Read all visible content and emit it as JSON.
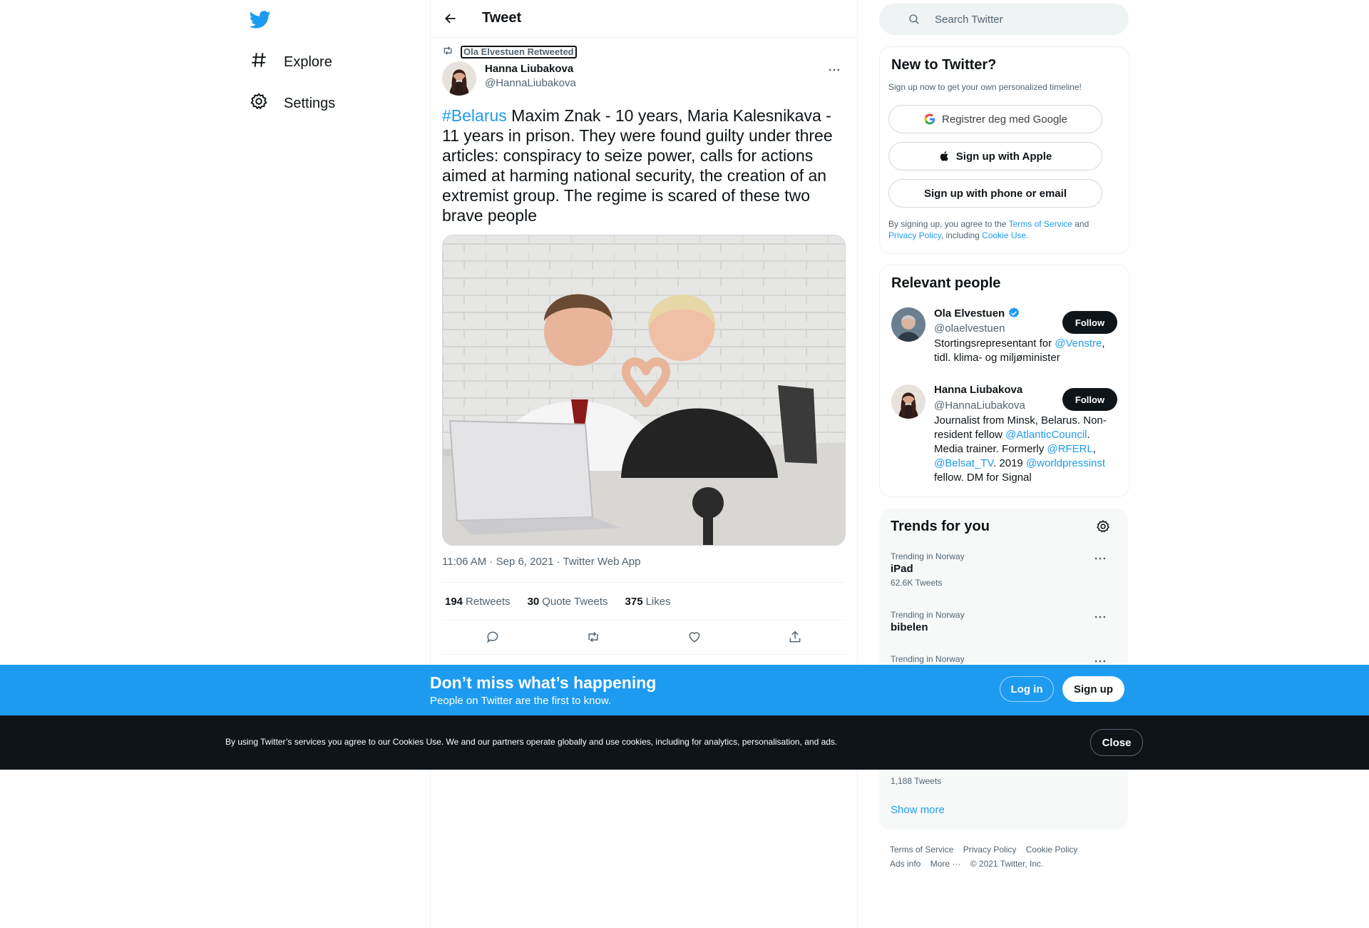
{
  "nav": {
    "items": [
      {
        "label": "Explore",
        "icon": "hashtag-icon"
      },
      {
        "label": "Settings",
        "icon": "gear-icon"
      }
    ]
  },
  "header": {
    "title": "Tweet"
  },
  "tweet": {
    "retweeted_by": "Ola Elvestuen Retweeted",
    "author_name": "Hanna Liubakova",
    "author_handle": "@HannaLiubakova",
    "hashtag": "#Belarus",
    "text": " Maxim Znak - 10 years, Maria Kalesnikava - 11 years in prison. They were found guilty under three articles: conspiracy to seize power, calls for actions aimed at harming national security, the creation of an extremist group. The regime is scared of these two brave people",
    "meta": "11:06 AM · Sep 6, 2021 · Twitter Web App",
    "retweets_count": "194",
    "retweets_label": "Retweets",
    "quotes_count": "30",
    "quotes_label": "Quote Tweets",
    "likes_count": "375",
    "likes_label": "Likes"
  },
  "search": {
    "placeholder": "Search Twitter"
  },
  "signup_card": {
    "title": "New to Twitter?",
    "subtitle": "Sign up now to get your own personalized timeline!",
    "google_label": "Registrer deg med Google",
    "apple_label": "Sign up with Apple",
    "phone_label": "Sign up with phone or email",
    "legal_prefix": "By signing up, you agree to the ",
    "terms_link": "Terms of Service",
    "legal_and": " and ",
    "privacy_link": "Privacy Policy",
    "legal_including": ", including ",
    "cookie_link": "Cookie Use."
  },
  "relevant_people": {
    "title": "Relevant people",
    "people": [
      {
        "name": "Ola Elvestuen",
        "handle": "@olaelvestuen",
        "follow_label": "Follow",
        "bio_text_1": "Stortingsrepresentant for ",
        "bio_link_1": "@Venstre",
        "bio_text_2": ", tidl. klima- og miljøminister"
      },
      {
        "name": "Hanna Liubakova",
        "handle": "@HannaLiubakova",
        "follow_label": "Follow",
        "bio_text_1": "Journalist from Minsk, Belarus. Non-resident fellow ",
        "bio_link_1": "@AtlanticCouncil",
        "bio_text_2": ". Media trainer. Formerly ",
        "bio_link_2": "@RFERL",
        "bio_text_3": ", ",
        "bio_link_3": "@Belsat_TV",
        "bio_text_4": ". 2019 ",
        "bio_link_4": "@worldpressinst",
        "bio_text_5": " fellow. DM for Signal"
      }
    ]
  },
  "trends": {
    "title": "Trends for you",
    "items": [
      {
        "context": "Trending in Norway",
        "name": "iPad",
        "count": "62.6K Tweets"
      },
      {
        "context": "Trending in Norway",
        "name": "bibelen"
      },
      {
        "context": "Trending in Norway"
      }
    ],
    "hidden_count": "1,188 Tweets",
    "show_more": "Show more"
  },
  "footer": {
    "terms": "Terms of Service",
    "privacy": "Privacy Policy",
    "cookie": "Cookie Policy",
    "ads": "Ads info",
    "more": "More ···",
    "copyright": "© 2021 Twitter, Inc."
  },
  "banner": {
    "title": "Don’t miss what’s happening",
    "subtitle": "People on Twitter are the first to know.",
    "login_label": "Log in",
    "signup_label": "Sign up"
  },
  "cookie_bar": {
    "text": "By using Twitter’s services you agree to our Cookies Use. We and our partners operate globally and use cookies, including for analytics, personalisation, and ads.",
    "close_label": "Close"
  },
  "colors": {
    "accent": "#1d9bf0",
    "text": "#0f1419",
    "secondary": "#536471",
    "cookie_bar": "#0f1419"
  }
}
